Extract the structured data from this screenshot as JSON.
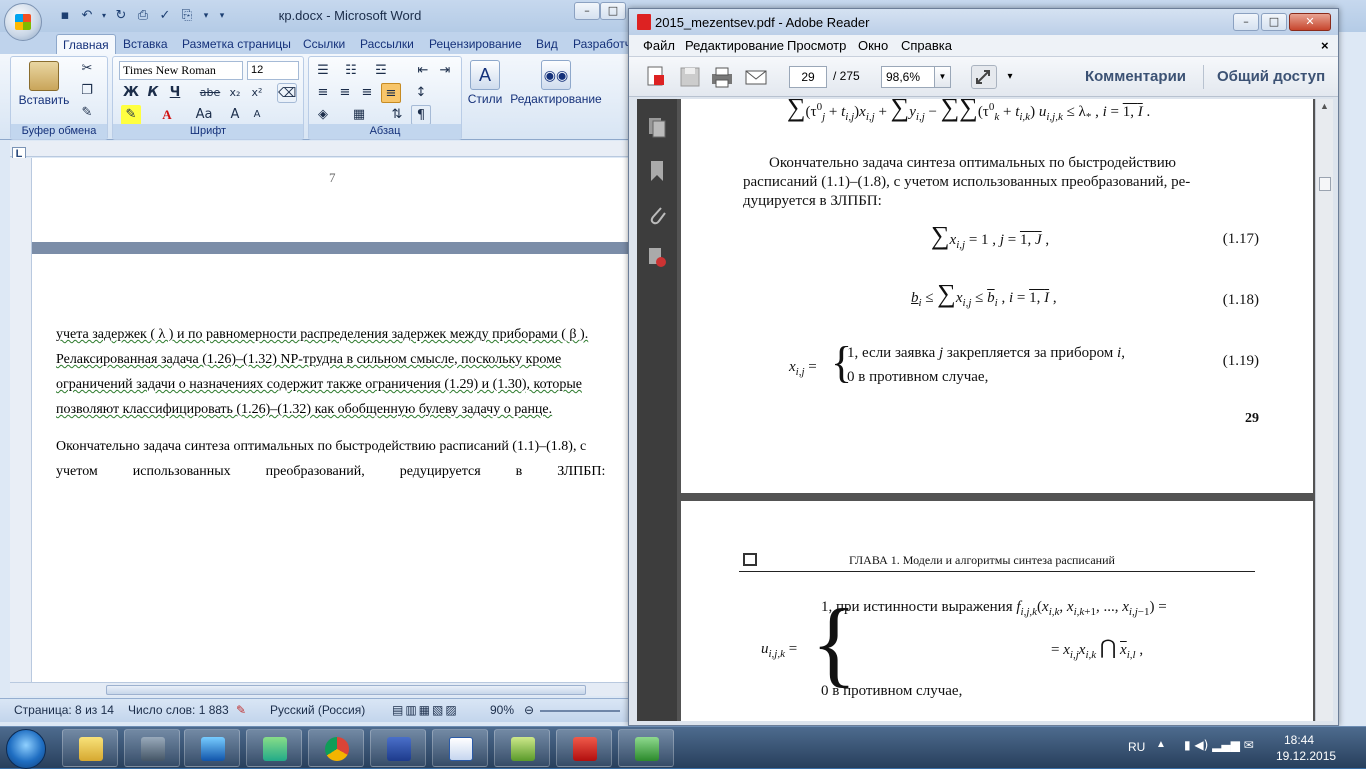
{
  "word": {
    "title": "кр.docx - Microsoft Word",
    "tabs": [
      "Главная",
      "Вставка",
      "Разметка страницы",
      "Ссылки",
      "Рассылки",
      "Рецензирование",
      "Вид",
      "Разработч"
    ],
    "font_name": "Times New Roman",
    "font_size": "12",
    "groups": {
      "clipboard": "Буфер обмена",
      "font": "Шрифт",
      "paragraph": "Абзац"
    },
    "paste_label": "Вставить",
    "styles_label": "Стили",
    "editing_label": "Редактирование",
    "font_buttons": [
      "Ж",
      "К",
      "Ч",
      "abe",
      "x₂",
      "x²"
    ],
    "page_number": "7",
    "para1_lines": [
      "учета задержек ( λ ) и по равномерности  распределения задержек между приборами ( β ).",
      "Релаксированная  задача  (1.26)–(1.32)  NP-трудна  в  сильном  смысле,  поскольку  кроме",
      "ограничений задачи о назначениях содержит также ограничения (1.29) и (1.30), которые",
      "позволяют классифицировать (1.26)–(1.32) как обобщенную булеву задачу о ранце."
    ],
    "para2_lines": [
      "Окончательно задача синтеза оптимальных по быстродействию расписаний (1.1)–(1.8), с",
      "учетом          использованных          преобразований,          редуцируется          в          ЗЛПБП:"
    ],
    "status": {
      "page": "Страница: 8 из 14",
      "words": "Число слов: 1 883",
      "lang": "Русский (Россия)",
      "zoom": "90%"
    }
  },
  "reader": {
    "title": "2015_mezentsev.pdf - Adobe Reader",
    "menu": [
      "Файл",
      "Редактирование",
      "Просмотр",
      "Окно",
      "Справка"
    ],
    "page": "29",
    "page_total": "/ 275",
    "zoom": "98,6%",
    "comments": "Комментарии",
    "share": "Общий доступ",
    "pdf_para": [
      "Окончательно задача синтеза оптимальных по быстродействию",
      "расписаний (1.1)–(1.8), с учетом использованных преобразований, ре-",
      "дуцируется в ЗЛПБП:"
    ],
    "eq_labels": [
      "(1.17)",
      "(1.18)",
      "(1.19)"
    ],
    "eq19_case1": "1,  если  заявка",
    "eq19_case1b": "закрепляется за  прибором",
    "eq19_case2": "0   в противном  случае,",
    "page_num": "29",
    "chapter_header": "ГЛАВА 1. Модели и алгоритмы синтеза расписаний",
    "eq_u_case1": "1, при  истинности  выражения",
    "eq_u_case2": "0   в противном  случае,"
  },
  "taskbar": {
    "lang": "RU",
    "time": "18:44",
    "date": "19.12.2015"
  }
}
